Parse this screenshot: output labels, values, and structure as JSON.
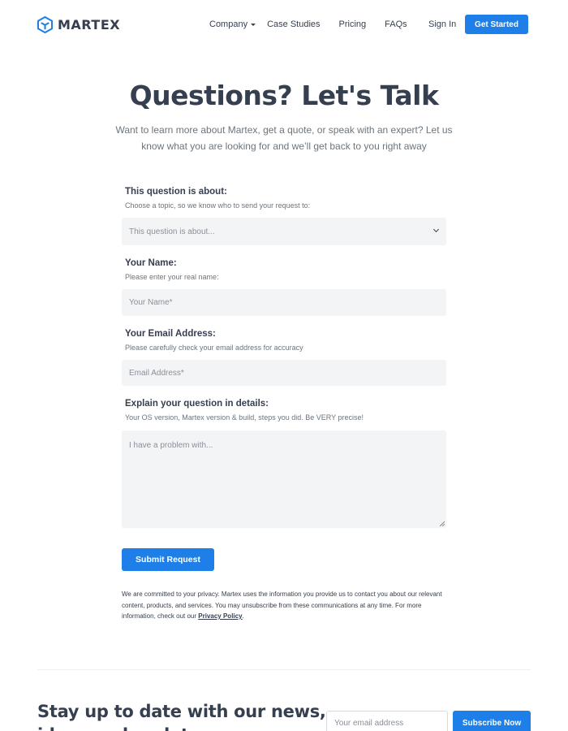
{
  "header": {
    "brand": "MARTEX",
    "brand_color": "#1e7fe8",
    "nav": [
      {
        "label": "Company",
        "has_dropdown": true
      },
      {
        "label": "Case Studies"
      },
      {
        "label": "Pricing"
      },
      {
        "label": "FAQs"
      }
    ],
    "signin_label": "Sign In",
    "cta_label": "Get Started"
  },
  "hero": {
    "title": "Questions? Let's Talk",
    "subtitle": "Want to learn more about Martex, get a quote, or speak with an expert? Let us know what you are looking for and we’ll get back to you right away"
  },
  "form": {
    "topic": {
      "label": "This question is about:",
      "hint": "Choose a topic, so we know who to send your request to:",
      "value": "This question is about..."
    },
    "name": {
      "label": "Your Name:",
      "hint": "Please enter your real name:",
      "placeholder": "Your Name*"
    },
    "email": {
      "label": "Your Email Address:",
      "hint": "Please carefully check your email address for accuracy",
      "placeholder": "Email Address*"
    },
    "details": {
      "label": "Explain your question in details:",
      "hint": "Your OS version, Martex version & build, steps you did. Be VERY precise!",
      "placeholder": "I have a problem with..."
    },
    "submit_label": "Submit Request",
    "privacy_text": "We are committed to your privacy. Martex uses the information you provide us to contact you about our relevant content, products, and services. You may unsubscribe from these communications at any time. For more information, check out our ",
    "privacy_link": "Privacy Policy",
    "privacy_end": "."
  },
  "newsletter": {
    "title": "Stay up to date with our news, ideas and updates",
    "input_placeholder": "Your email address",
    "button_label": "Subscribe Now"
  },
  "colors": {
    "accent": "#1e7fe8",
    "heading": "#353f4f",
    "field_bg": "#f3f4f6"
  }
}
